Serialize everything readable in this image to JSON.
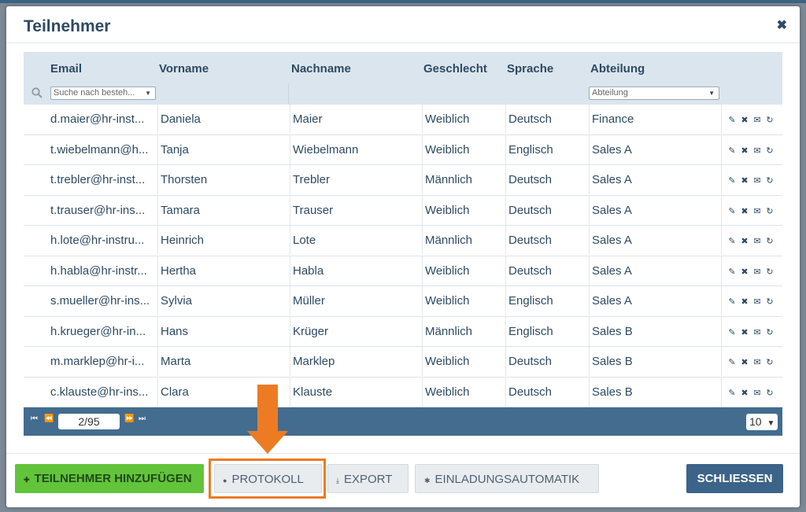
{
  "dialog": {
    "title": "Teilnehmer",
    "close_glyph": "✖"
  },
  "columns": [
    "Email",
    "Vorname",
    "Nachname",
    "Geschlecht",
    "Sprache",
    "Abteilung"
  ],
  "filters": {
    "email_placeholder": "Suche nach besteh...",
    "abteilung_placeholder": "Abteilung"
  },
  "rows": [
    {
      "email": "d.maier@hr-inst...",
      "vorname": "Daniela",
      "nachname": "Maier",
      "geschlecht": "Weiblich",
      "sprache": "Deutsch",
      "abteilung": "Finance"
    },
    {
      "email": "t.wiebelmann@h...",
      "vorname": "Tanja",
      "nachname": "Wiebelmann",
      "geschlecht": "Weiblich",
      "sprache": "Englisch",
      "abteilung": "Sales A"
    },
    {
      "email": "t.trebler@hr-inst...",
      "vorname": "Thorsten",
      "nachname": "Trebler",
      "geschlecht": "Männlich",
      "sprache": "Deutsch",
      "abteilung": "Sales A"
    },
    {
      "email": "t.trauser@hr-ins...",
      "vorname": "Tamara",
      "nachname": "Trauser",
      "geschlecht": "Weiblich",
      "sprache": "Deutsch",
      "abteilung": "Sales A"
    },
    {
      "email": "h.lote@hr-instru...",
      "vorname": "Heinrich",
      "nachname": "Lote",
      "geschlecht": "Männlich",
      "sprache": "Deutsch",
      "abteilung": "Sales A"
    },
    {
      "email": "h.habla@hr-instr...",
      "vorname": "Hertha",
      "nachname": "Habla",
      "geschlecht": "Weiblich",
      "sprache": "Deutsch",
      "abteilung": "Sales A"
    },
    {
      "email": "s.mueller@hr-ins...",
      "vorname": "Sylvia",
      "nachname": "Müller",
      "geschlecht": "Weiblich",
      "sprache": "Englisch",
      "abteilung": "Sales A"
    },
    {
      "email": "h.krueger@hr-in...",
      "vorname": "Hans",
      "nachname": "Krüger",
      "geschlecht": "Männlich",
      "sprache": "Englisch",
      "abteilung": "Sales B"
    },
    {
      "email": "m.marklep@hr-i...",
      "vorname": "Marta",
      "nachname": "Marklep",
      "geschlecht": "Weiblich",
      "sprache": "Deutsch",
      "abteilung": "Sales B"
    },
    {
      "email": "c.klauste@hr-ins...",
      "vorname": "Clara",
      "nachname": "Klauste",
      "geschlecht": "Weiblich",
      "sprache": "Deutsch",
      "abteilung": "Sales B"
    }
  ],
  "row_actions": [
    "edit-icon",
    "delete-icon",
    "mail-icon",
    "refresh-icon"
  ],
  "pager": {
    "page_display": "2/95",
    "page_size": "10"
  },
  "footer": {
    "add_label": "TEILNEHMER HINZUFÜGEN",
    "protokoll_label": "PROTOKOLL",
    "export_label": "EXPORT",
    "einladung_label": "EINLADUNGSAUTOMATIK",
    "close_label": "SCHLIESSEN"
  },
  "colors": {
    "accent_orange": "#ec7b24",
    "primary_blue": "#3c6388",
    "add_green": "#62c43a"
  }
}
